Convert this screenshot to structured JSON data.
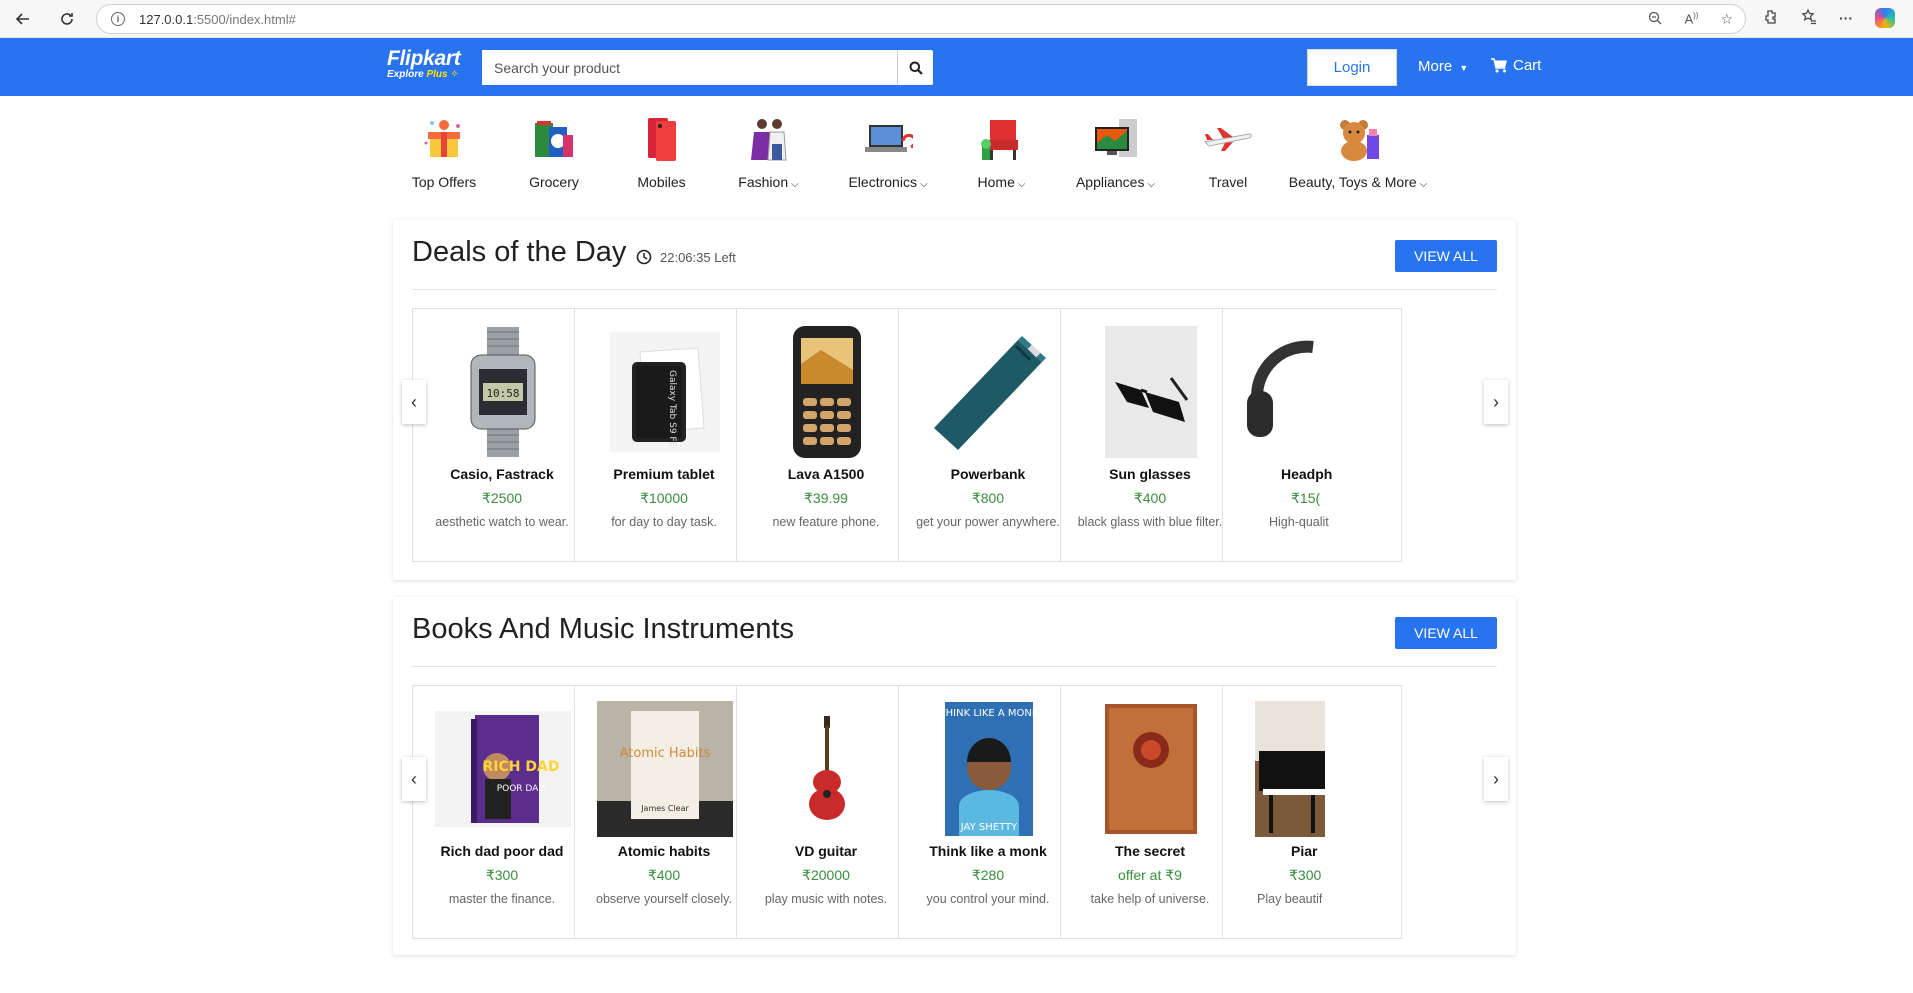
{
  "browser": {
    "url_host": "127.0.0.1",
    "url_rest": ":5500/index.html#"
  },
  "header": {
    "logo_name": "Flipkart",
    "logo_sub": "Explore",
    "logo_plus": "Plus",
    "search_placeholder": "Search your product",
    "login_label": "Login",
    "more_label": "More",
    "cart_label": "Cart",
    "brand_color": "#2874f0"
  },
  "categories": [
    {
      "label": "Top Offers",
      "has_dropdown": false,
      "icon": "gift-icon"
    },
    {
      "label": "Grocery",
      "has_dropdown": false,
      "icon": "grocery-icon"
    },
    {
      "label": "Mobiles",
      "has_dropdown": false,
      "icon": "mobile-icon"
    },
    {
      "label": "Fashion",
      "has_dropdown": true,
      "icon": "fashion-icon"
    },
    {
      "label": "Electronics",
      "has_dropdown": true,
      "icon": "laptop-icon"
    },
    {
      "label": "Home",
      "has_dropdown": true,
      "icon": "chair-icon"
    },
    {
      "label": "Appliances",
      "has_dropdown": true,
      "icon": "tv-icon"
    },
    {
      "label": "Travel",
      "has_dropdown": false,
      "icon": "airplane-icon"
    },
    {
      "label": "Beauty, Toys & More",
      "has_dropdown": true,
      "icon": "teddy-icon"
    }
  ],
  "sections": [
    {
      "title": "Deals of the Day",
      "timer": "22:06:35 Left",
      "view_all": "VIEW ALL",
      "products": [
        {
          "name": "Casio, Fastrack",
          "price": "₹2500",
          "desc": "aesthetic watch to wear.",
          "icon": "watch-image"
        },
        {
          "name": "Premium tablet",
          "price": "₹10000",
          "desc": "for day to day task.",
          "icon": "tablet-image"
        },
        {
          "name": "Lava A1500",
          "price": "₹39.99",
          "desc": "new feature phone.",
          "icon": "feature-phone-image"
        },
        {
          "name": "Powerbank",
          "price": "₹800",
          "desc": "get your power anywhere.",
          "icon": "powerbank-image"
        },
        {
          "name": "Sun glasses",
          "price": "₹400",
          "desc": "black glass with blue filter.",
          "icon": "sunglasses-image"
        },
        {
          "name": "Headph",
          "price": "₹15(",
          "desc": "High-qualit",
          "icon": "headphones-image"
        }
      ]
    },
    {
      "title": "Books And Music Instruments",
      "timer": "",
      "view_all": "VIEW ALL",
      "products": [
        {
          "name": "Rich dad poor dad",
          "price": "₹300",
          "desc": "master the finance.",
          "icon": "book-rich-dad-image",
          "book_title": "RICH DAD",
          "book_sub": "POOR DAD"
        },
        {
          "name": "Atomic habits",
          "price": "₹400",
          "desc": "observe yourself closely.",
          "icon": "book-atomic-habits-image",
          "book_title": "Atomic Habits",
          "book_sub": "James Clear"
        },
        {
          "name": "VD guitar",
          "price": "₹20000",
          "desc": "play music with notes.",
          "icon": "guitar-image"
        },
        {
          "name": "Think like a monk",
          "price": "₹280",
          "desc": "you control your mind.",
          "icon": "book-monk-image",
          "book_title": "THINK LIKE A MONK",
          "book_sub": "JAY SHETTY"
        },
        {
          "name": "The secret",
          "price": "offer at ₹9",
          "desc": "take help of universe.",
          "icon": "book-secret-image"
        },
        {
          "name": "Piar",
          "price": "₹300",
          "desc": "Play beautif",
          "icon": "piano-image"
        }
      ]
    }
  ]
}
